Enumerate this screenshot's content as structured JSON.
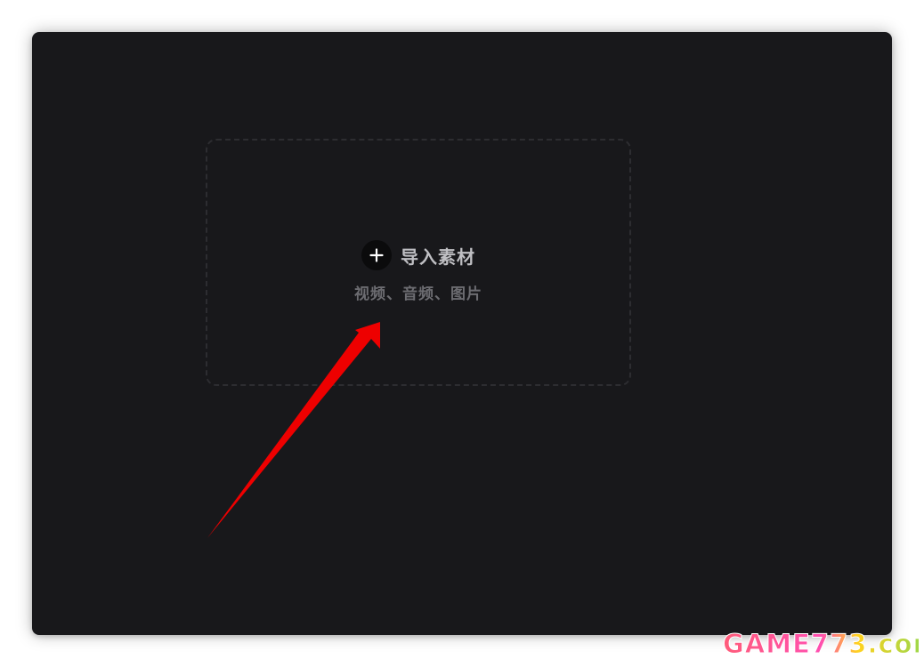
{
  "import_area": {
    "title": "导入素材",
    "subtitle": "视频、音频、图片",
    "icon": "plus-icon"
  },
  "annotation": {
    "arrow_color": "#ee0000"
  },
  "watermark": {
    "text": "GAME773.com"
  },
  "colors": {
    "window_bg": "#18181b",
    "drop_zone_border": "#2d2d31",
    "title_text": "#bfbfc3",
    "subtitle_text": "#6c6c71"
  }
}
